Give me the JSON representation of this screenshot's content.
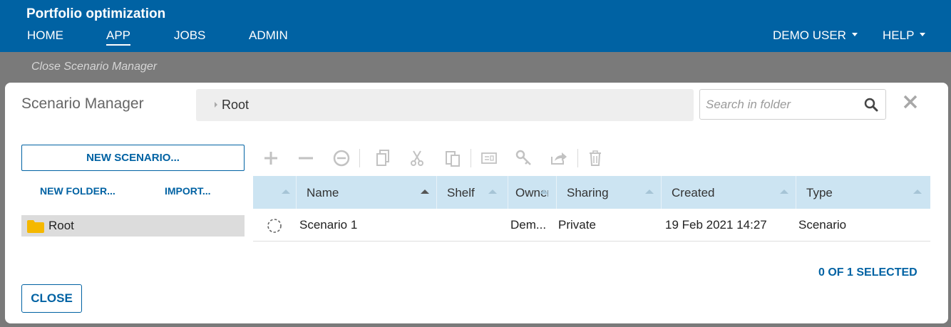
{
  "app": {
    "title": "Portfolio optimization"
  },
  "nav": {
    "home": "HOME",
    "app": "APP",
    "jobs": "JOBS",
    "admin": "ADMIN",
    "user": "DEMO USER",
    "help": "HELP"
  },
  "backdrop": {
    "close_link": "Close Scenario Manager"
  },
  "modal": {
    "title": "Scenario Manager",
    "breadcrumb": "Root",
    "search_placeholder": "Search in folder",
    "new_scenario": "NEW SCENARIO...",
    "new_folder": "NEW FOLDER...",
    "import": "IMPORT...",
    "tree_root": "Root",
    "selected_count": "0 OF 1 SELECTED",
    "close": "CLOSE"
  },
  "toolbar_icons": [
    "add-icon",
    "remove-icon",
    "remove-circle-icon",
    "copy-icon",
    "cut-icon",
    "paste-icon",
    "properties-icon",
    "key-icon",
    "share-icon",
    "delete-icon"
  ],
  "table": {
    "columns": [
      "Name",
      "Shelf",
      "Owner",
      "Sharing",
      "Created",
      "Type"
    ],
    "rows": [
      {
        "name": "Scenario 1",
        "shelf": "",
        "owner": "Dem...",
        "sharing": "Private",
        "created": "19 Feb 2021 14:27",
        "type": "Scenario"
      }
    ]
  },
  "colors": {
    "brand": "#0062a3",
    "header_row": "#cce4f2",
    "folder": "#f5b800"
  }
}
